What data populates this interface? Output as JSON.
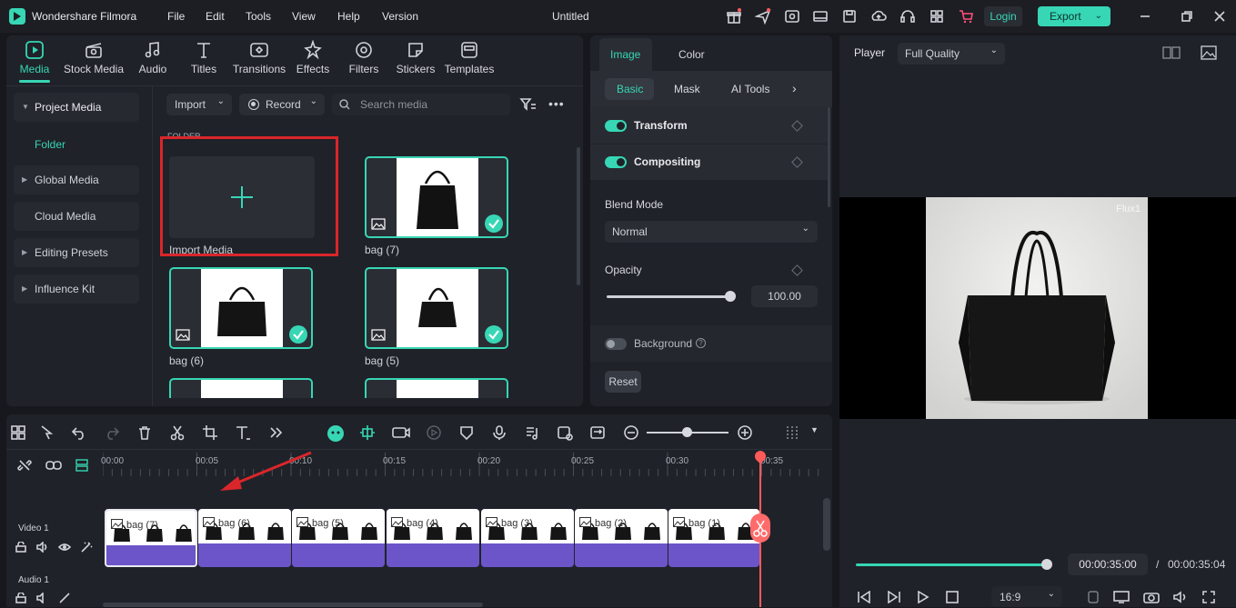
{
  "app": {
    "name": "Wondershare Filmora",
    "menu": [
      "File",
      "Edit",
      "Tools",
      "View",
      "Help",
      "Version"
    ],
    "document_title": "Untitled",
    "login_label": "Login",
    "export_label": "Export"
  },
  "toolbar": {
    "tools": [
      {
        "label": "Media",
        "icon": "media-icon",
        "active": true
      },
      {
        "label": "Stock Media",
        "icon": "stock-media-icon"
      },
      {
        "label": "Audio",
        "icon": "audio-icon"
      },
      {
        "label": "Titles",
        "icon": "titles-icon"
      },
      {
        "label": "Transitions",
        "icon": "transitions-icon"
      },
      {
        "label": "Effects",
        "icon": "effects-icon"
      },
      {
        "label": "Filters",
        "icon": "filters-icon"
      },
      {
        "label": "Stickers",
        "icon": "stickers-icon"
      },
      {
        "label": "Templates",
        "icon": "templates-icon"
      }
    ]
  },
  "sidebar": {
    "items": [
      {
        "label": "Project Media",
        "expanded": true
      },
      {
        "label": "Folder",
        "selected": true
      },
      {
        "label": "Global Media"
      },
      {
        "label": "Cloud Media"
      },
      {
        "label": "Editing Presets"
      },
      {
        "label": "Influence Kit"
      }
    ]
  },
  "media": {
    "import_label": "Import",
    "record_label": "Record",
    "search_placeholder": "Search media",
    "folder_header": "FOLDER",
    "import_media_label": "Import Media",
    "items": [
      {
        "label": "bag (7)"
      },
      {
        "label": "bag (6)"
      },
      {
        "label": "bag (5)"
      }
    ]
  },
  "properties": {
    "tabs": [
      "Image",
      "Color"
    ],
    "subtabs": [
      "Basic",
      "Mask",
      "AI Tools"
    ],
    "transform_label": "Transform",
    "compositing_label": "Compositing",
    "blend_mode_label": "Blend Mode",
    "blend_mode_value": "Normal",
    "opacity_label": "Opacity",
    "opacity_value": "100.00",
    "background_label": "Background",
    "reset_label": "Reset"
  },
  "player": {
    "label": "Player",
    "quality": "Full Quality",
    "watermark": "Flux1",
    "current_time": "00:00:35:00",
    "separator": "/",
    "total_time": "00:00:35:04",
    "aspect": "16:9",
    "progress": 1.0
  },
  "timeline": {
    "ruler": [
      "00:00",
      "00:05",
      "00:10",
      "00:15",
      "00:20",
      "00:25",
      "00:30",
      "00:35"
    ],
    "tracks": [
      "Video 1",
      "Audio 1"
    ],
    "clips": [
      "bag (7)",
      "bag (6)",
      "bag (5)",
      "bag (4)",
      "bag (3)",
      "bag (2)",
      "bag (1)"
    ]
  },
  "colors": {
    "accent": "#37d6b5",
    "highlight_red": "#d9262b",
    "clip_purple": "#6c55c9",
    "playhead": "#ff5a5a"
  }
}
